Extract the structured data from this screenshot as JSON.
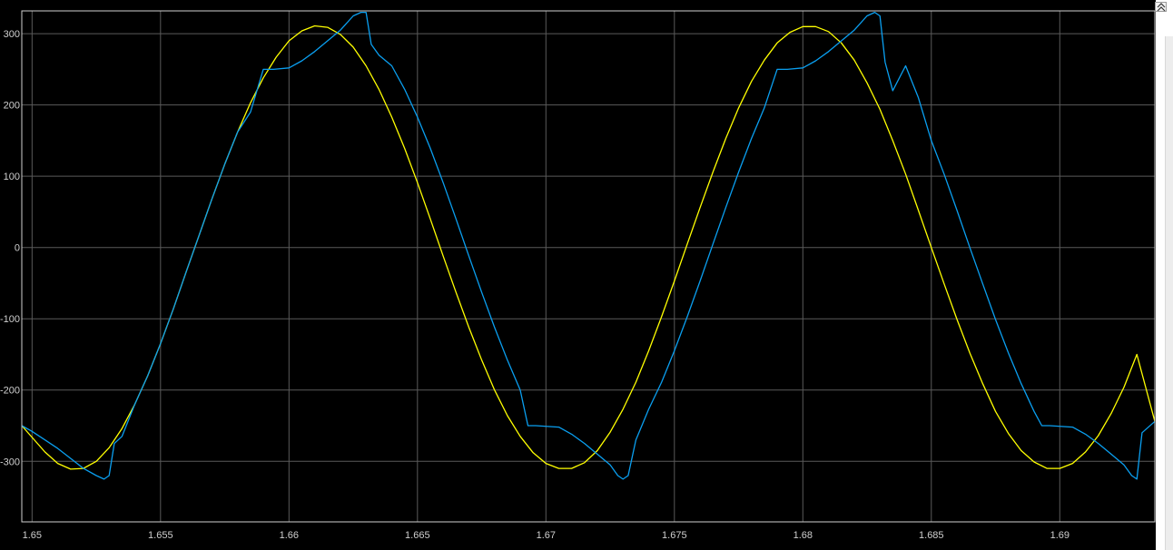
{
  "window": {
    "expand_button_icon": "expand-arrows-icon"
  },
  "colors": {
    "background": "#000000",
    "grid": "#5a5a5a",
    "axes": "#d0d0d0",
    "tick_text": "#cfcfcf",
    "series_reference": "#ffff00",
    "series_measured": "#0a9ff0"
  },
  "chart_data": {
    "type": "line",
    "title": "",
    "xlabel": "",
    "ylabel": "",
    "xlim": [
      1.6496,
      1.6937
    ],
    "ylim": [
      -385,
      332
    ],
    "grid": true,
    "legend": "none",
    "xticks": [
      1.65,
      1.655,
      1.66,
      1.665,
      1.67,
      1.675,
      1.68,
      1.685,
      1.69
    ],
    "xtick_labels": [
      "1.65",
      "1.655",
      "1.66",
      "1.665",
      "1.67",
      "1.675",
      "1.68",
      "1.685",
      "1.69"
    ],
    "yticks": [
      300,
      200,
      100,
      0,
      -100,
      -200,
      -300
    ],
    "ytick_labels": [
      "300",
      "200",
      "100",
      "0",
      "-100",
      "-200",
      "-300"
    ],
    "series": [
      {
        "color": "#ffff00",
        "x": [
          1.6496,
          1.6505,
          1.651,
          1.6515,
          1.652,
          1.6525,
          1.653,
          1.6535,
          1.654,
          1.6545,
          1.655,
          1.6555,
          1.656,
          1.6565,
          1.657,
          1.6575,
          1.658,
          1.6585,
          1.659,
          1.6595,
          1.66,
          1.6605,
          1.661,
          1.6615,
          1.662,
          1.6625,
          1.663,
          1.6635,
          1.664,
          1.6645,
          1.665,
          1.6655,
          1.666,
          1.6665,
          1.667,
          1.6675,
          1.668,
          1.6685,
          1.669,
          1.6695,
          1.67,
          1.6705,
          1.671,
          1.6715,
          1.672,
          1.6725,
          1.673,
          1.6735,
          1.674,
          1.6745,
          1.675,
          1.6755,
          1.676,
          1.6765,
          1.677,
          1.6775,
          1.678,
          1.6785,
          1.679,
          1.6795,
          1.68,
          1.6805,
          1.681,
          1.6815,
          1.682,
          1.6825,
          1.683,
          1.6835,
          1.684,
          1.6845,
          1.685,
          1.6855,
          1.686,
          1.6865,
          1.687,
          1.6875,
          1.688,
          1.6885,
          1.689,
          1.6895,
          1.69,
          1.6905,
          1.691,
          1.6915,
          1.692,
          1.6925,
          1.693,
          1.6937
        ],
        "y": [
          -250,
          -287,
          -303,
          -311,
          -310,
          -300,
          -281,
          -254,
          -220,
          -180,
          -135,
          -86,
          -34,
          17,
          68,
          117,
          162,
          203,
          238,
          267,
          290,
          304,
          311,
          309,
          299,
          281,
          255,
          222,
          183,
          139,
          91,
          40,
          -12,
          -63,
          -112,
          -158,
          -200,
          -236,
          -265,
          -288,
          -303,
          -310,
          -310,
          -302,
          -285,
          -259,
          -227,
          -189,
          -145,
          -97,
          -47,
          5,
          56,
          106,
          153,
          196,
          233,
          263,
          287,
          302,
          310,
          310,
          303,
          287,
          263,
          231,
          194,
          150,
          103,
          52,
          0,
          -51,
          -101,
          -148,
          -191,
          -230,
          -261,
          -285,
          -301,
          -310,
          -310,
          -303,
          -287,
          -264,
          -233,
          -196,
          -150,
          -244
        ]
      },
      {
        "color": "#0a9ff0",
        "x": [
          1.6496,
          1.65,
          1.6505,
          1.651,
          1.6515,
          1.652,
          1.6525,
          1.6528,
          1.653,
          1.6532,
          1.6535,
          1.654,
          1.6545,
          1.655,
          1.6555,
          1.656,
          1.6565,
          1.657,
          1.6575,
          1.658,
          1.6585,
          1.659,
          1.6592,
          1.6594,
          1.66,
          1.6605,
          1.661,
          1.6615,
          1.662,
          1.6625,
          1.6628,
          1.663,
          1.6632,
          1.6635,
          1.664,
          1.6645,
          1.665,
          1.6655,
          1.666,
          1.6665,
          1.667,
          1.6675,
          1.668,
          1.6685,
          1.669,
          1.6693,
          1.6696,
          1.6705,
          1.671,
          1.6715,
          1.672,
          1.6725,
          1.6728,
          1.673,
          1.6732,
          1.6735,
          1.674,
          1.6745,
          1.675,
          1.6755,
          1.676,
          1.6765,
          1.677,
          1.6775,
          1.678,
          1.6785,
          1.679,
          1.6792,
          1.6794,
          1.68,
          1.6805,
          1.681,
          1.6815,
          1.682,
          1.6825,
          1.6828,
          1.683,
          1.6832,
          1.6835,
          1.684,
          1.6845,
          1.685,
          1.6855,
          1.686,
          1.6865,
          1.687,
          1.6875,
          1.688,
          1.6885,
          1.689,
          1.6893,
          1.6896,
          1.6905,
          1.691,
          1.6915,
          1.692,
          1.6925,
          1.6928,
          1.693,
          1.6932,
          1.6937
        ],
        "y": [
          -250,
          -258,
          -270,
          -282,
          -296,
          -310,
          -320,
          -325,
          -320,
          -275,
          -265,
          -220,
          -180,
          -135,
          -86,
          -34,
          17,
          68,
          117,
          162,
          190,
          250,
          250,
          250,
          252,
          262,
          275,
          290,
          305,
          325,
          330,
          330,
          285,
          270,
          255,
          222,
          183,
          139,
          91,
          40,
          -12,
          -63,
          -112,
          -158,
          -200,
          -250,
          -250,
          -252,
          -262,
          -275,
          -290,
          -305,
          -320,
          -325,
          -320,
          -270,
          -227,
          -189,
          -145,
          -97,
          -47,
          5,
          56,
          106,
          153,
          196,
          250,
          250,
          250,
          252,
          262,
          275,
          290,
          305,
          325,
          330,
          325,
          260,
          220,
          255,
          210,
          150,
          103,
          52,
          0,
          -51,
          -101,
          -148,
          -191,
          -230,
          -250,
          -250,
          -252,
          -262,
          -275,
          -290,
          -305,
          -320,
          -325,
          -260,
          -244
        ]
      }
    ]
  }
}
